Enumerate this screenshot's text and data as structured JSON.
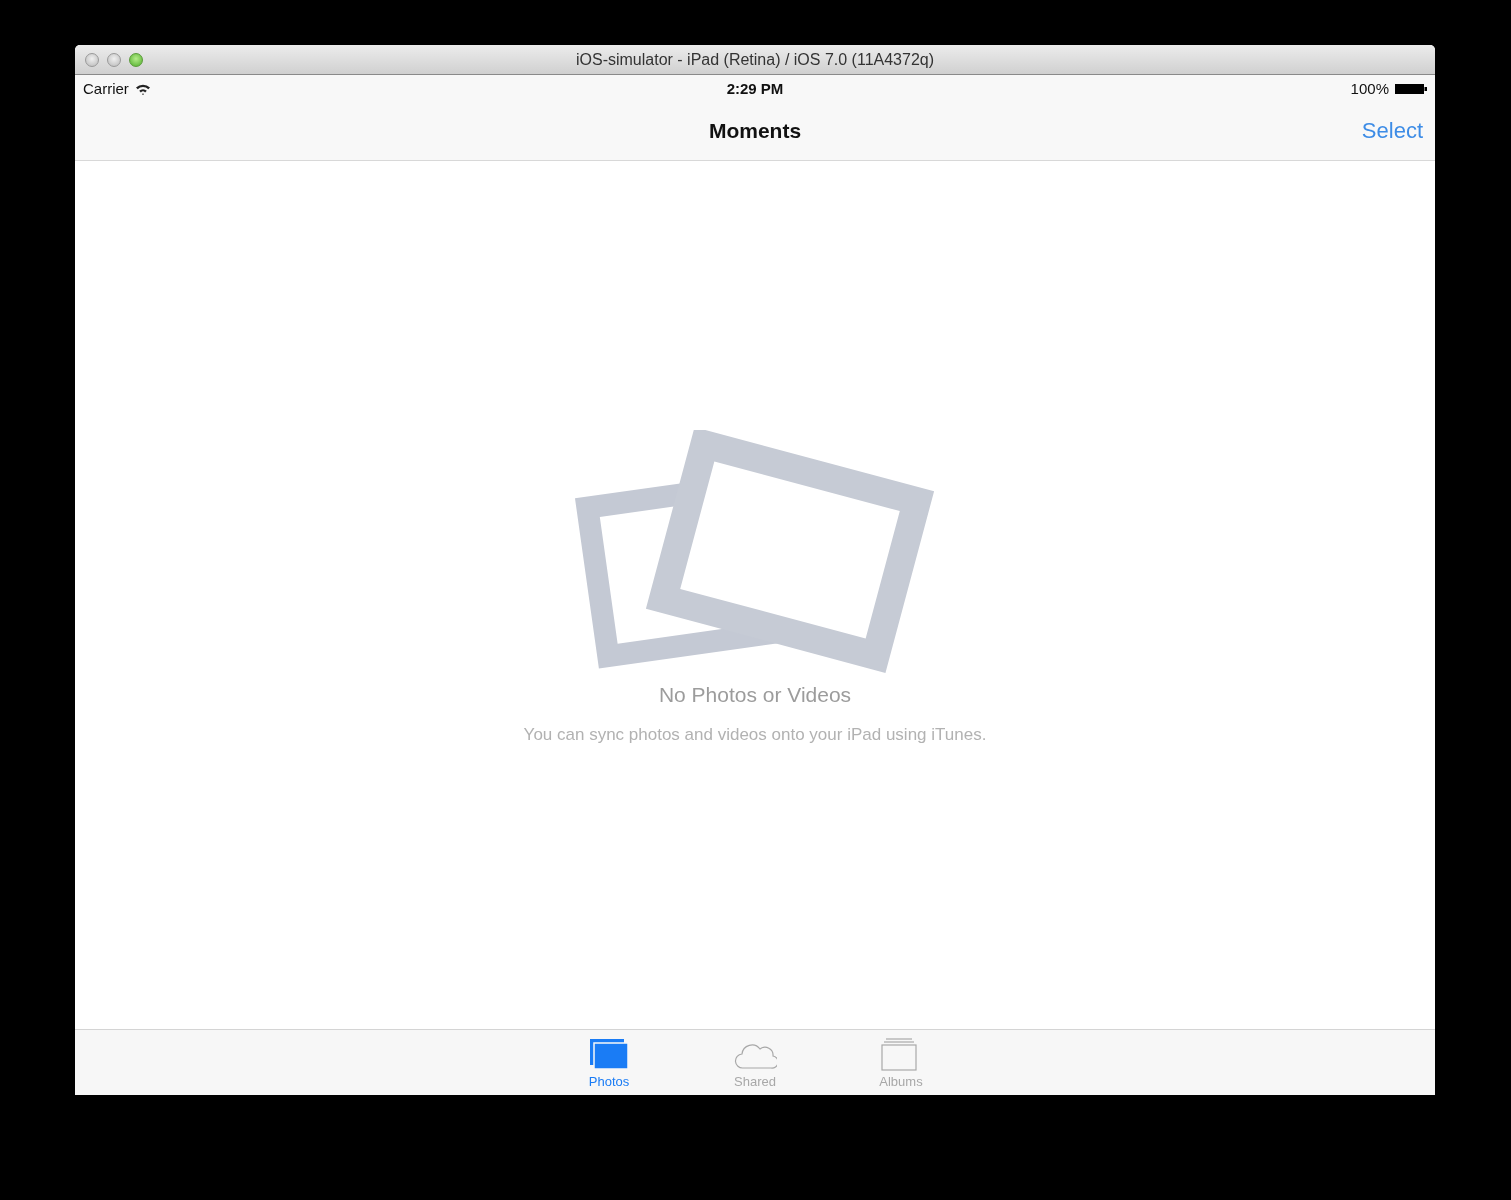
{
  "window": {
    "title": "iOS-simulator - iPad (Retina) / iOS 7.0 (11A4372q)"
  },
  "status_bar": {
    "carrier": "Carrier",
    "time": "2:29 PM",
    "battery": "100%"
  },
  "nav_bar": {
    "title": "Moments",
    "action": "Select"
  },
  "empty_state": {
    "title": "No Photos or Videos",
    "message": "You can sync photos and videos onto your iPad using iTunes."
  },
  "tabs": [
    {
      "label": "Photos",
      "kind": "photos",
      "selected": true
    },
    {
      "label": "Shared",
      "kind": "cloud",
      "selected": false
    },
    {
      "label": "Albums",
      "kind": "albums",
      "selected": false
    }
  ]
}
